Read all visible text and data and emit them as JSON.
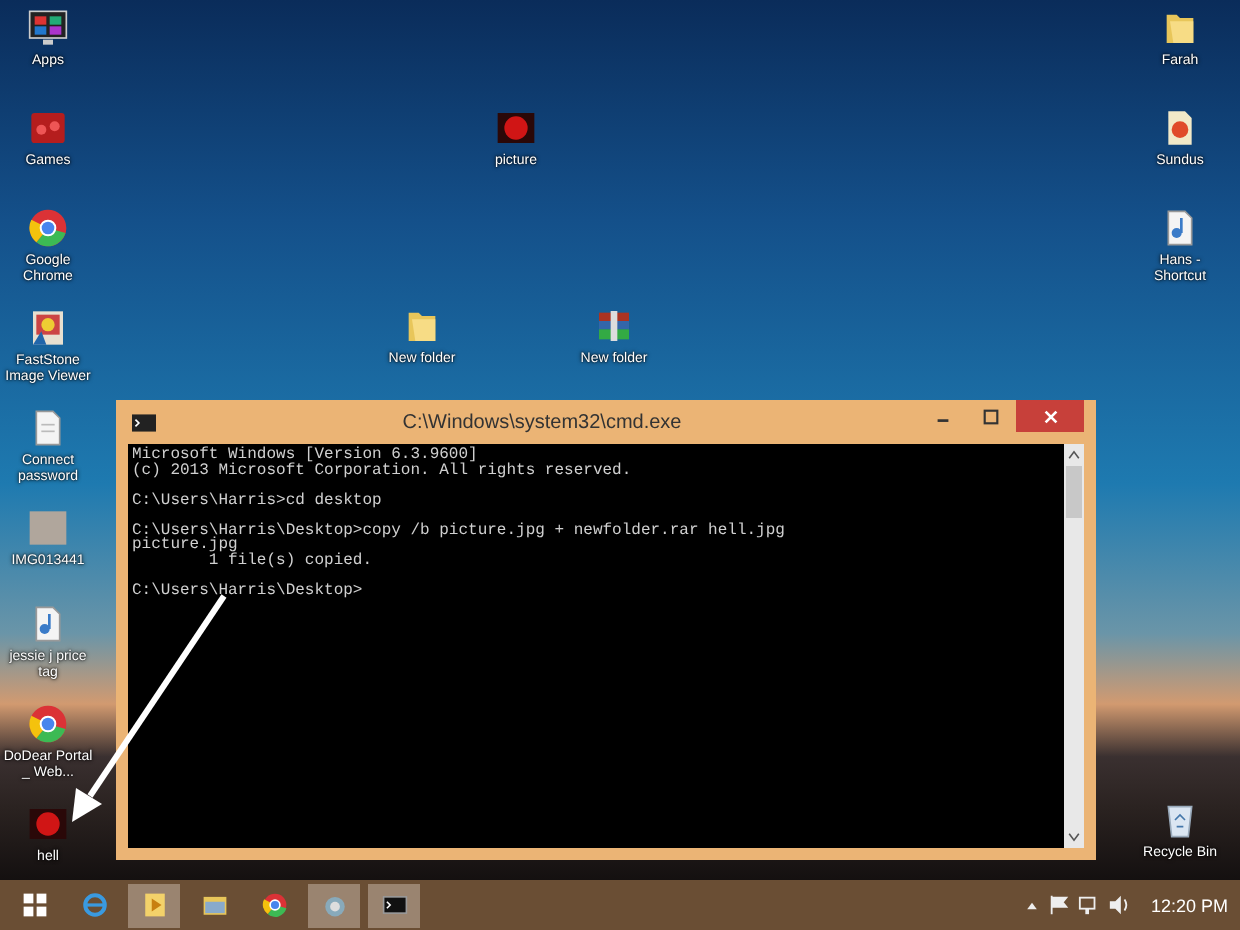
{
  "desktop_icons": [
    {
      "kind": "apps",
      "label": "Apps"
    },
    {
      "kind": "games",
      "label": "Games"
    },
    {
      "kind": "chrome",
      "label": "Google Chrome"
    },
    {
      "kind": "faststone",
      "label": "FastStone Image Viewer"
    },
    {
      "kind": "document",
      "label": "Connect password"
    },
    {
      "kind": "image",
      "label": "IMG013441"
    },
    {
      "kind": "audio",
      "label": "jessie j price tag"
    },
    {
      "kind": "chrome",
      "label": "DoDear Portal _ Web..."
    },
    {
      "kind": "video",
      "label": "hell"
    },
    {
      "kind": "folder",
      "label": "Farah"
    },
    {
      "kind": "shortcut",
      "label": "Sundus"
    },
    {
      "kind": "audio",
      "label": "Hans - Shortcut"
    },
    {
      "kind": "recycle",
      "label": "Recycle Bin"
    },
    {
      "kind": "video",
      "label": "picture"
    },
    {
      "kind": "folder",
      "label": "New folder"
    },
    {
      "kind": "rar",
      "label": "New folder"
    }
  ],
  "cmd_window": {
    "title": "C:\\Windows\\system32\\cmd.exe",
    "blocks": [
      [
        "Microsoft Windows [Version 6.3.9600]",
        "(c) 2013 Microsoft Corporation. All rights reserved."
      ],
      [
        "C:\\Users\\Harris>cd desktop"
      ],
      [
        "C:\\Users\\Harris\\Desktop>copy /b picture.jpg + newfolder.rar hell.jpg",
        "picture.jpg",
        "        1 file(s) copied."
      ],
      [
        "C:\\Users\\Harris\\Desktop>"
      ]
    ]
  },
  "taskbar": {
    "items": [
      {
        "kind": "start",
        "selected": false
      },
      {
        "kind": "ie",
        "selected": false
      },
      {
        "kind": "media",
        "selected": true
      },
      {
        "kind": "explorer",
        "selected": false
      },
      {
        "kind": "chrome",
        "selected": false
      },
      {
        "kind": "app",
        "selected": true
      },
      {
        "kind": "cmd",
        "selected": true
      }
    ],
    "clock": "12:20 PM"
  }
}
